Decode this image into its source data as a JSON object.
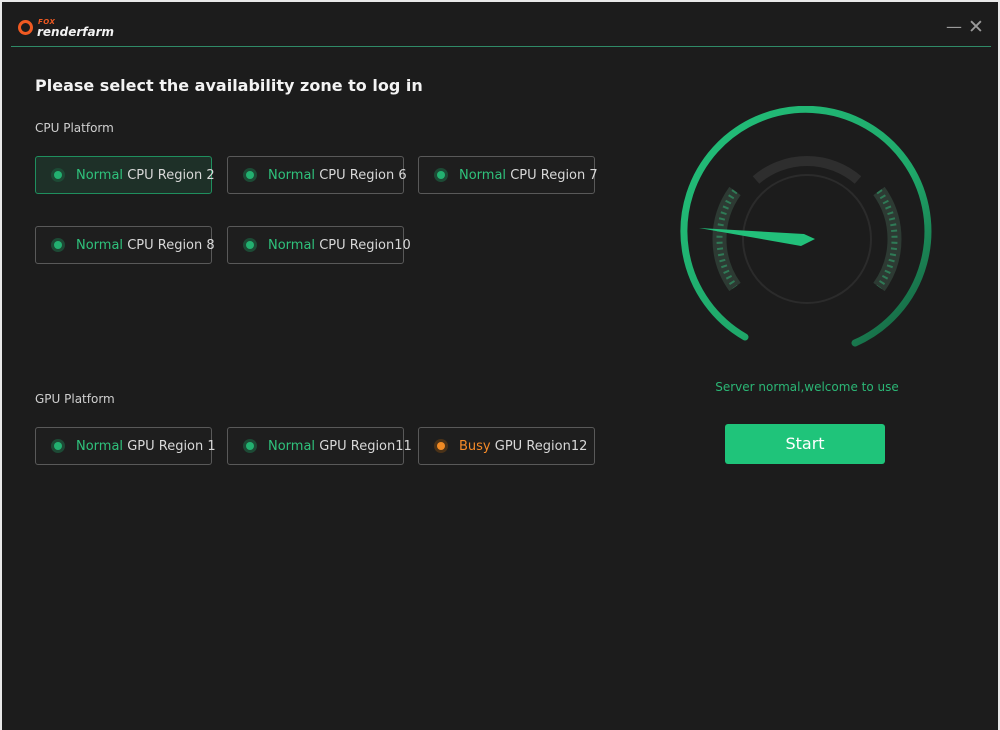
{
  "app": {
    "logo_top": "FOX",
    "logo_bottom": "renderfarm",
    "minimize_label": "—",
    "close_label": "✕"
  },
  "page_title": "Please select the availability zone to log in",
  "cpu_platform": {
    "label": "CPU Platform",
    "regions": [
      {
        "status": "Normal",
        "name": "CPU Region 2",
        "selected": true
      },
      {
        "status": "Normal",
        "name": "CPU Region 6",
        "selected": false
      },
      {
        "status": "Normal",
        "name": "CPU Region 7",
        "selected": false
      },
      {
        "status": "Normal",
        "name": "CPU Region 8",
        "selected": false
      },
      {
        "status": "Normal",
        "name": "CPU Region10",
        "selected": false
      }
    ]
  },
  "gpu_platform": {
    "label": "GPU Platform",
    "regions": [
      {
        "status": "Normal",
        "name": "GPU Region 1",
        "selected": false
      },
      {
        "status": "Normal",
        "name": "GPU Region11",
        "selected": false
      },
      {
        "status": "Busy",
        "name": "GPU Region12",
        "selected": false
      }
    ]
  },
  "server": {
    "status_text": "Server normal,welcome to use",
    "start_label": "Start"
  },
  "colors": {
    "accent": "#1fc47a",
    "normal": "#2fc27c",
    "busy": "#f58a28",
    "background": "#1c1c1c"
  },
  "icons": {
    "status_normal": "green-dot-icon",
    "status_busy": "orange-dot-icon",
    "gauge": "speedometer-icon"
  }
}
